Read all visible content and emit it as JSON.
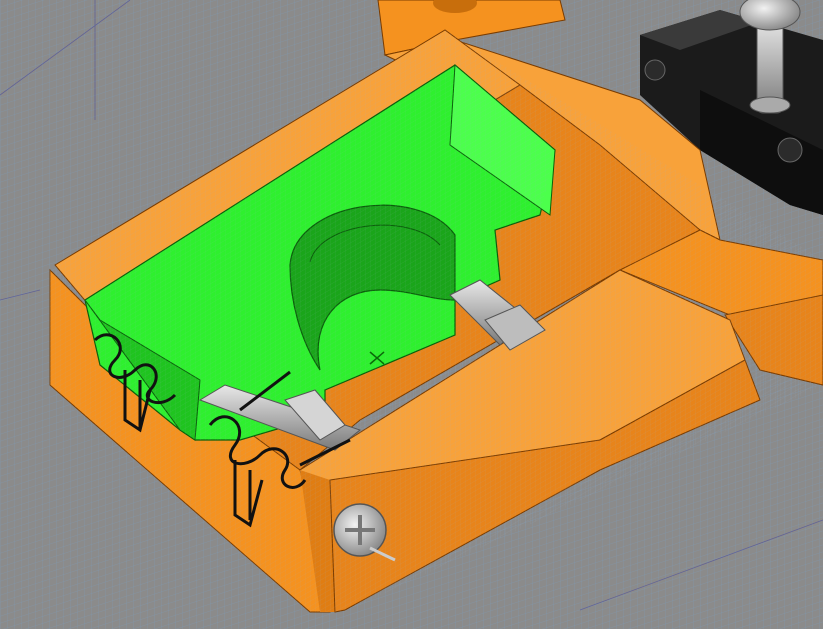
{
  "viewport": {
    "background_color": "#8b8b8b",
    "grid_color": "#7aa0c8",
    "cursor_icon": "crosshair-icon"
  },
  "model": {
    "bracket_color": "#f5921f",
    "bracket_dark_color": "#c86e0c",
    "carriage_color": "#2ef02e",
    "carriage_dark_color": "#1aa51a",
    "switch_color": "#1b1b1b",
    "metal_color": "#c8c8c8",
    "spring_color": "#222222"
  }
}
